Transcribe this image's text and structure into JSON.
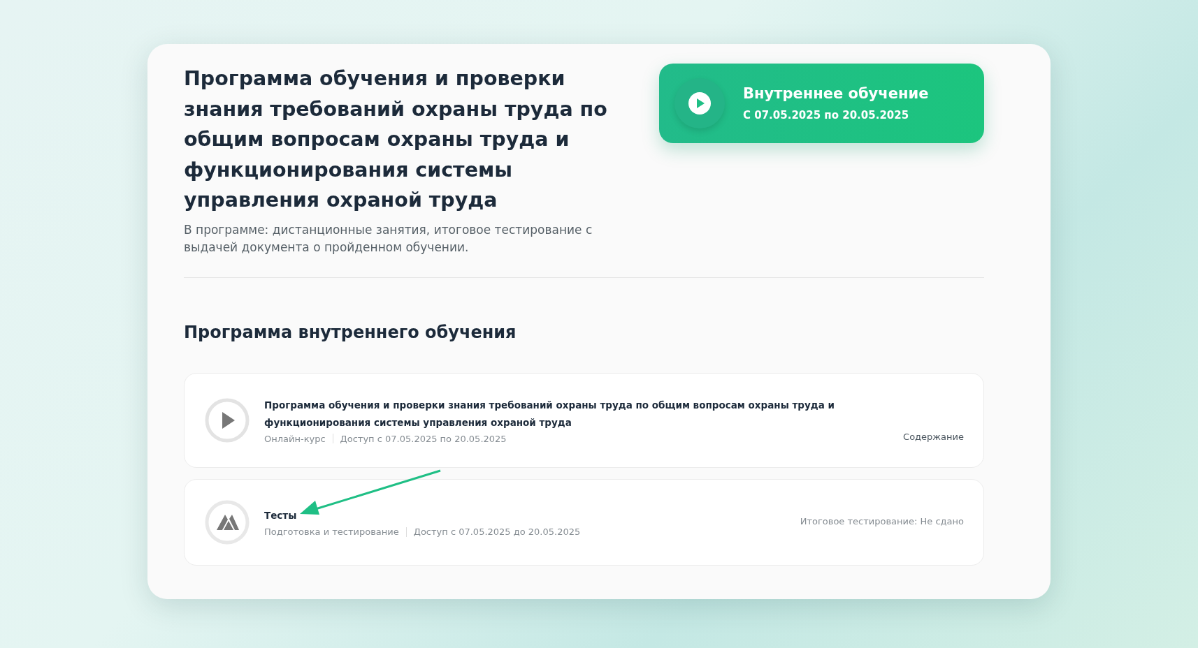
{
  "program": {
    "title": "Программа обучения и проверки знания требований охраны труда по общим вопросам охраны труда и функционирования системы управления охраной труда",
    "description": "В программе: дистанционные занятия, итоговое тестирование с выдачей документа о пройденном обучении."
  },
  "banner": {
    "title": "Внутреннее обучение",
    "dates": "С 07.05.2025 по 20.05.2025"
  },
  "section": {
    "title": "Программа внутреннего обучения",
    "items": [
      {
        "kind": "course",
        "title": "Программа обучения и проверки знания требований охраны труда по общим вопросам охраны труда и функционирования системы управления охраной труда",
        "type": "Онлайн-курс",
        "access": "Доступ с 07.05.2025 по 20.05.2025",
        "action": "Содержание",
        "arrow": false
      },
      {
        "kind": "test",
        "title": "Тесты",
        "type": "Подготовка и тестирование",
        "access": "Доступ с 07.05.2025 до 20.05.2025",
        "status": "Итоговое тестирование: Не сдано",
        "arrow": true
      }
    ]
  }
}
